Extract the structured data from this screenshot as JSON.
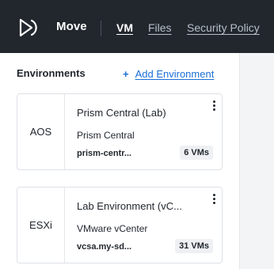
{
  "header": {
    "app_name": "Move",
    "tabs": [
      {
        "label": "VM",
        "active": true
      },
      {
        "label": "Files",
        "active": false
      },
      {
        "label": "Security Policy",
        "active": false
      }
    ],
    "logo_icon": "play-circle-logo-icon",
    "background": "#22272e"
  },
  "environments": {
    "heading": "Environments",
    "add_plus": "+",
    "add_label": "Add Environment",
    "accent": "#1b6fd6",
    "items": [
      {
        "type": "AOS",
        "name": "Prism Central (Lab)",
        "kind": "Prism Central",
        "host": "prism-centr...",
        "vm_count": "6 VMs"
      },
      {
        "type": "ESXi",
        "name": "Lab Environment (vC...",
        "kind": "VMware vCenter",
        "host": "vcsa.my-sd...",
        "vm_count": "31 VMs"
      }
    ]
  }
}
